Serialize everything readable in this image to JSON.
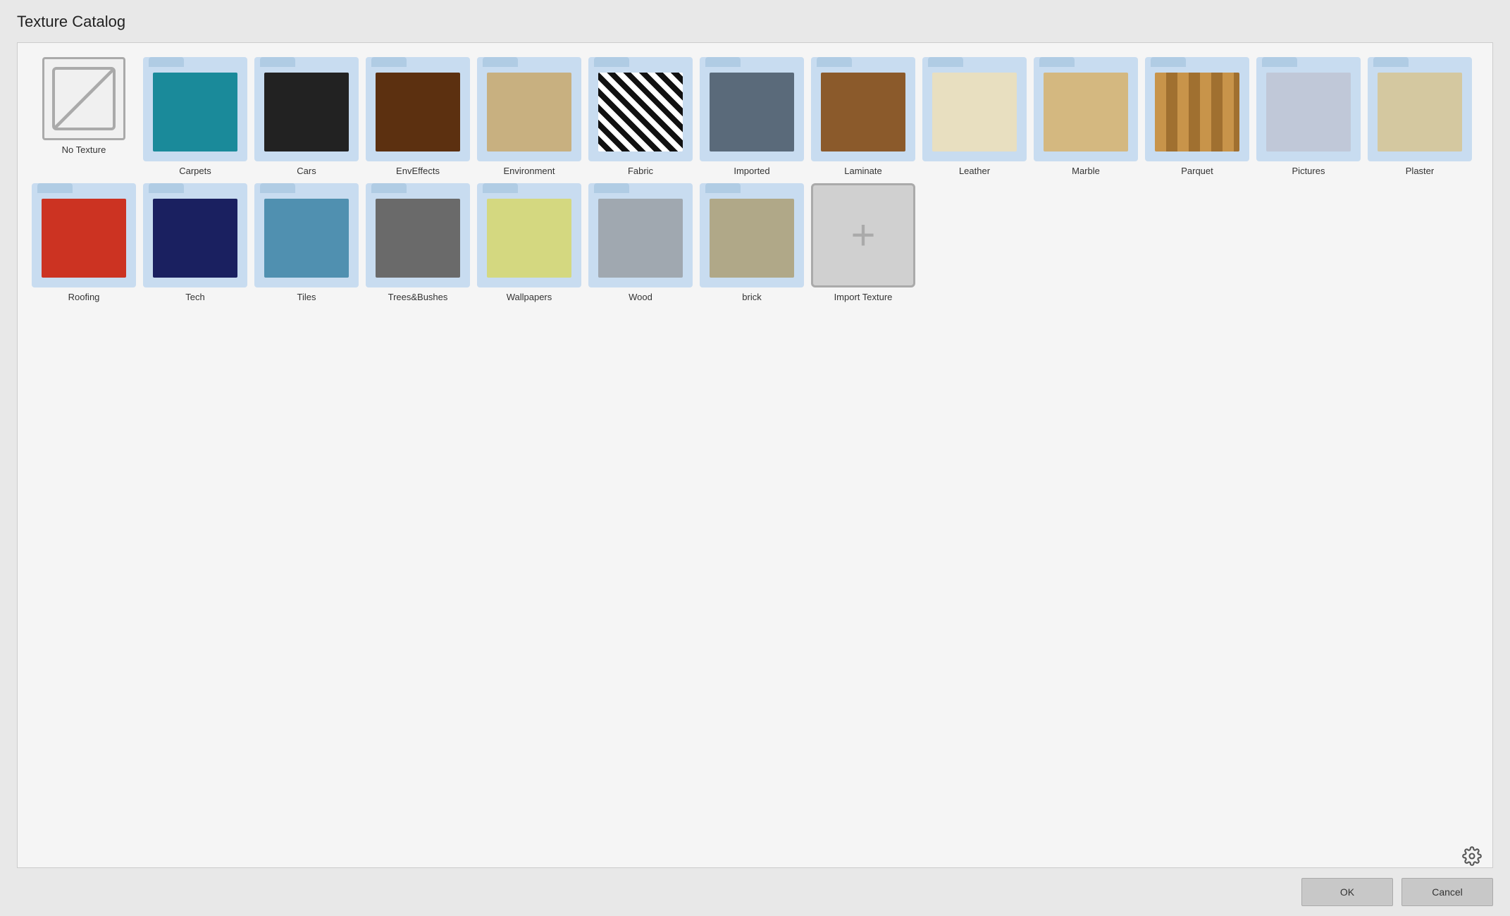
{
  "title": "Texture Catalog",
  "items_row1": [
    {
      "id": "no-texture",
      "label": "No Texture",
      "type": "no-texture"
    },
    {
      "id": "carpets",
      "label": "Carpets",
      "type": "folder",
      "thumb": "thumb-teal"
    },
    {
      "id": "cars",
      "label": "Cars",
      "type": "folder",
      "thumb": "thumb-dark"
    },
    {
      "id": "enveffects",
      "label": "EnvEffects",
      "type": "folder",
      "thumb": "thumb-brown"
    },
    {
      "id": "environment",
      "label": "Environment",
      "type": "folder",
      "thumb": "thumb-sand"
    },
    {
      "id": "fabric",
      "label": "Fabric",
      "type": "folder",
      "thumb": "thumb-zebra"
    },
    {
      "id": "imported",
      "label": "Imported",
      "type": "folder",
      "thumb": "thumb-slate"
    },
    {
      "id": "laminate",
      "label": "Laminate",
      "type": "folder",
      "thumb": "thumb-wood-brown"
    },
    {
      "id": "leather",
      "label": "Leather",
      "type": "folder",
      "thumb": "thumb-cream"
    },
    {
      "id": "marble",
      "label": "Marble",
      "type": "folder",
      "thumb": "thumb-beige"
    },
    {
      "id": "parquet",
      "label": "Parquet",
      "type": "folder",
      "thumb": "thumb-parquet"
    },
    {
      "id": "pictures",
      "label": "Pictures",
      "type": "folder",
      "thumb": "thumb-people"
    }
  ],
  "items_row2": [
    {
      "id": "plaster",
      "label": "Plaster",
      "type": "folder",
      "thumb": "thumb-plaster"
    },
    {
      "id": "roofing",
      "label": "Roofing",
      "type": "folder",
      "thumb": "thumb-roofing"
    },
    {
      "id": "tech",
      "label": "Tech",
      "type": "folder",
      "thumb": "thumb-tech"
    },
    {
      "id": "tiles",
      "label": "Tiles",
      "type": "folder",
      "thumb": "thumb-tiles"
    },
    {
      "id": "treesbushes",
      "label": "Trees&Bushes",
      "type": "folder",
      "thumb": "thumb-treebush"
    },
    {
      "id": "wallpapers",
      "label": "Wallpapers",
      "type": "folder",
      "thumb": "thumb-yellow"
    },
    {
      "id": "wood",
      "label": "Wood",
      "type": "folder",
      "thumb": "thumb-metallic"
    },
    {
      "id": "brick",
      "label": "brick",
      "type": "folder",
      "thumb": "thumb-stone"
    },
    {
      "id": "import-texture",
      "label": "Import Texture",
      "type": "import"
    }
  ],
  "buttons": {
    "ok": "OK",
    "cancel": "Cancel"
  }
}
